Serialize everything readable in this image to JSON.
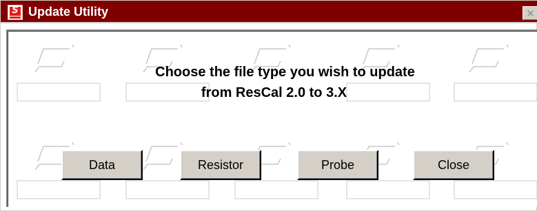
{
  "window": {
    "title": "Update Utility",
    "close_glyph": "×",
    "icon_glyph": "S"
  },
  "message": {
    "line1": "Choose the file type you wish to update",
    "line2": "from ResCal 2.0 to 3.X"
  },
  "buttons": {
    "data": "Data",
    "resistor": "Resistor",
    "probe": "Probe",
    "close": "Close"
  },
  "colors": {
    "titlebar": "#800000",
    "button_face": "#d4d0c8",
    "icon_red": "#e31b1b",
    "watermark": "#c8c8c8"
  },
  "icons": {
    "app_icon": "caltrac-logo-icon",
    "close_icon": "close-icon"
  }
}
